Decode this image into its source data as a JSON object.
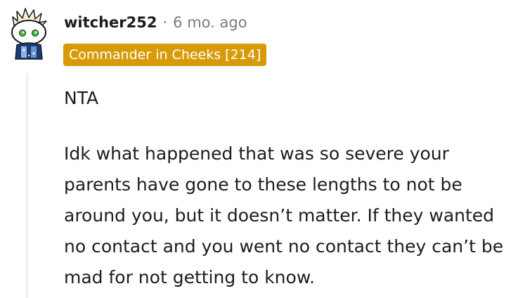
{
  "comment": {
    "author": "witcher252",
    "separator": "·",
    "timestamp": "6 mo. ago",
    "flair": "Commander in Cheeks [214]",
    "paragraphs": [
      "NTA",
      "Idk what happened that was so severe your parents have gone to these lengths to not be around you, but it doesn’t matter. If they wanted no contact and you went no contact they can’t be mad for not getting to know."
    ]
  },
  "colors": {
    "flair_background": "#d79b09",
    "text": "#1c1c1c",
    "muted_text": "#7c7c7c",
    "thread_line": "#edeff1"
  },
  "icons": {
    "avatar": "reddit-snoo-avatar-icon"
  }
}
